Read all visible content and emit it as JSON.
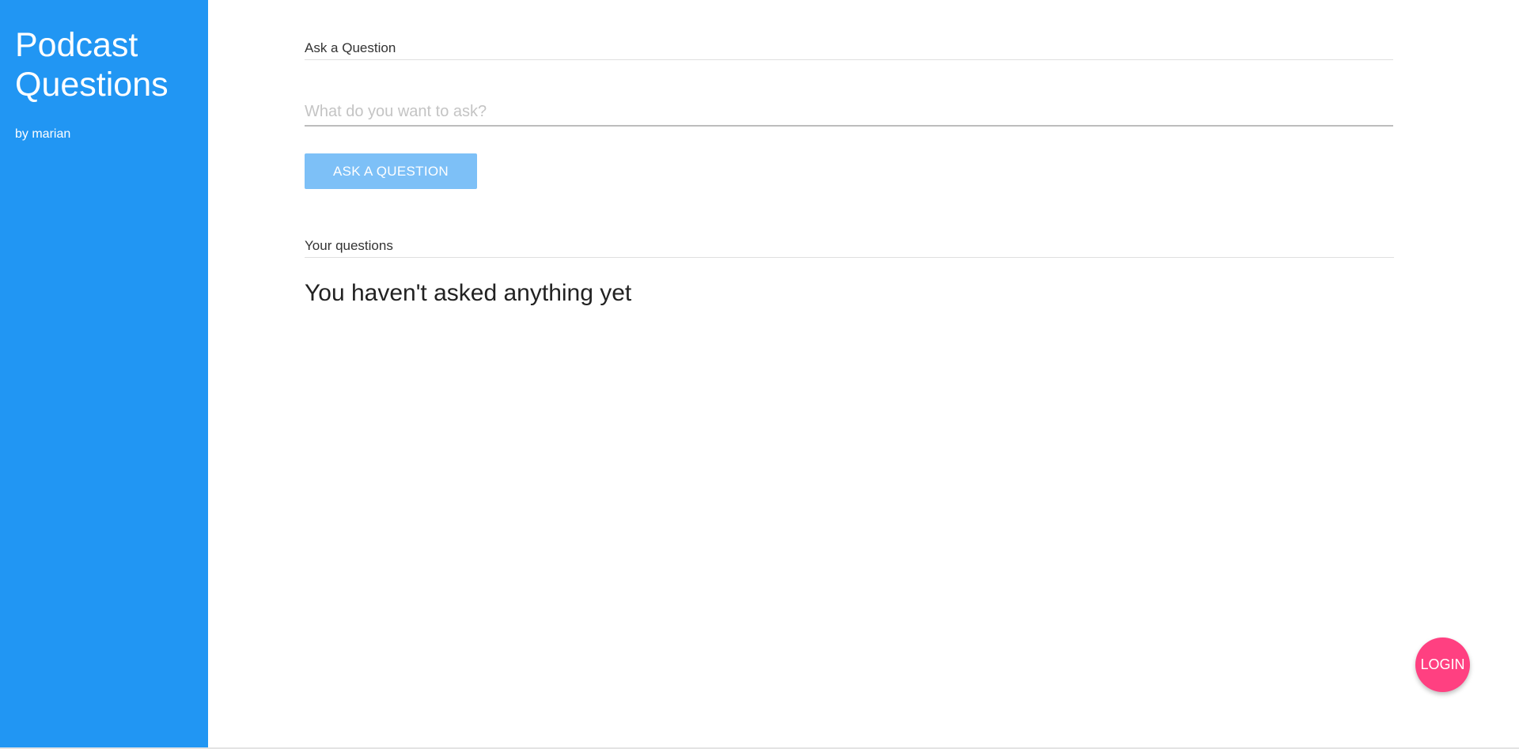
{
  "sidebar": {
    "title": "Podcast Questions",
    "author": "by marian"
  },
  "ask_section": {
    "header": "Ask a Question",
    "input_placeholder": "What do you want to ask?",
    "input_value": "",
    "button_label": "ASK A QUESTION"
  },
  "questions_section": {
    "header": "Your questions",
    "empty_message": "You haven't asked anything yet"
  },
  "login_button": {
    "label": "LOGIN"
  },
  "colors": {
    "sidebar_bg": "#2196f3",
    "button_bg": "#7dc0f7",
    "login_bg": "#ff4081"
  }
}
